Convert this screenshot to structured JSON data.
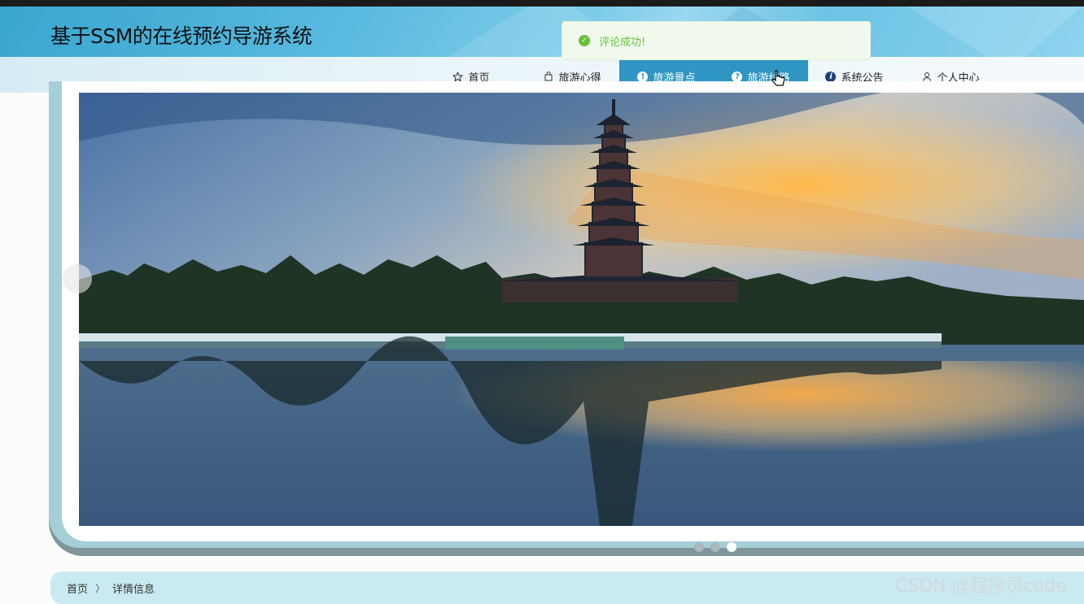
{
  "header": {
    "title": "基于SSM的在线预约导游系统"
  },
  "toast": {
    "message": "评论成功!"
  },
  "nav": {
    "items": [
      {
        "label": "首页",
        "icon": "star-outline-icon"
      },
      {
        "label": "旅游心得",
        "icon": "bag-icon"
      },
      {
        "label": "旅游景点",
        "icon": "exclamation-circle-icon"
      },
      {
        "label": "旅游线路",
        "icon": "question-circle-icon"
      },
      {
        "label": "系统公告",
        "icon": "info-circle-icon"
      },
      {
        "label": "个人中心",
        "icon": "user-icon"
      }
    ]
  },
  "carousel": {
    "slide_count": 3,
    "active_index": 2
  },
  "breadcrumb": {
    "home": "首页",
    "separator": "〉",
    "current": "详情信息"
  },
  "watermark": "CSDN @程序员code",
  "colors": {
    "accent": "#2f96c3",
    "toast_bg": "#f0f9eb",
    "toast_text": "#67c23a"
  }
}
